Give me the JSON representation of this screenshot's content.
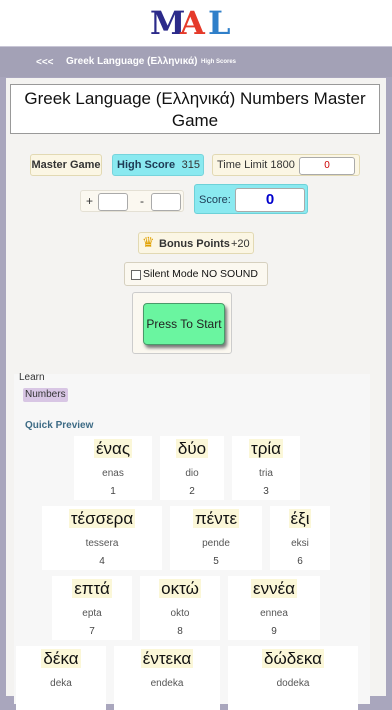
{
  "logo": {
    "letters": [
      "M",
      "A",
      "L"
    ],
    "colors": [
      "#2b2a8a",
      "#e53a2a",
      "#2f7fc9"
    ]
  },
  "nav": {
    "back": "<<<",
    "title": "Greek Language (Ελληνικά)",
    "high_scores": "High Scores"
  },
  "page_title": "Greek Language (Ελληνικά) Numbers Master Game",
  "stats": {
    "mode": "Master Game",
    "high_score_label": "High Score",
    "high_score_value": "315",
    "time_limit_label": "Time Limit 1800",
    "time_value": "0"
  },
  "answer": {
    "plus": "+",
    "minus": "-"
  },
  "score": {
    "label": "Score:",
    "value": "0"
  },
  "bonus": {
    "label": "Bonus Points",
    "value": "+20",
    "icon": "crown-icon"
  },
  "silent": {
    "label": "Silent Mode NO SOUND",
    "checked": false
  },
  "start_button": "Press To Start",
  "learn": {
    "label": "Learn",
    "category": "Numbers",
    "preview_label": "Quick Preview"
  },
  "cards": [
    {
      "greek": "ένας",
      "translit": "enas",
      "num": "1"
    },
    {
      "greek": "δύο",
      "translit": "dio",
      "num": "2"
    },
    {
      "greek": "τρία",
      "translit": "tria",
      "num": "3"
    },
    {
      "greek": "τέσσερα",
      "translit": "tessera",
      "num": "4"
    },
    {
      "greek": "πέντε",
      "translit": "pende",
      "num": "5"
    },
    {
      "greek": "έξι",
      "translit": "eksi",
      "num": "6"
    },
    {
      "greek": "επτά",
      "translit": "epta",
      "num": "7"
    },
    {
      "greek": "οκτώ",
      "translit": "okto",
      "num": "8"
    },
    {
      "greek": "εννέα",
      "translit": "ennea",
      "num": "9"
    },
    {
      "greek": "δέκα",
      "translit": "deka",
      "num": ""
    },
    {
      "greek": "έντεκα",
      "translit": "endeka",
      "num": ""
    },
    {
      "greek": "δώδεκα",
      "translit": "dodeka",
      "num": ""
    }
  ]
}
